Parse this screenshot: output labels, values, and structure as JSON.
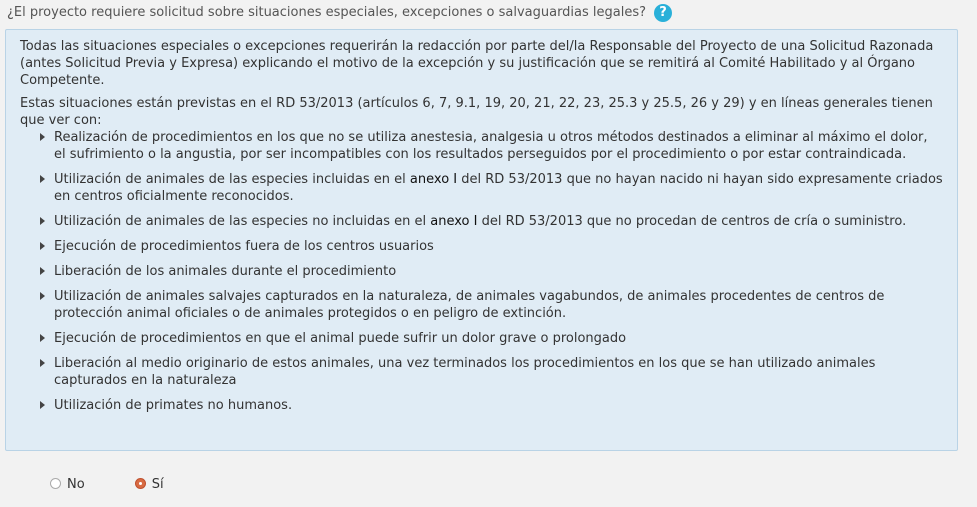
{
  "question": {
    "text": "¿El proyecto requiere solicitud sobre situaciones especiales, excepciones o salvaguardias legales?",
    "help_icon": "?"
  },
  "info": {
    "intro": "Todas las situaciones especiales o excepciones requerirán la redacción por parte del/la Responsable del Proyecto de una Solicitud Razonada (antes Solicitud Previa y Expresa) explicando el motivo de la excepción y su justificación que se remitirá al Comité Habilitado y al Órgano Competente.",
    "lead": "Estas situaciones están previstas en el RD 53/2013 (artículos 6, 7, 9.1, 19, 20, 21, 22, 23, 25.3 y 25.5, 26 y 29) y en líneas generales tienen que ver con:",
    "items": [
      "Realización de procedimientos en los que no se utiliza anestesia, analgesia u otros métodos destinados a eliminar al máximo el dolor, el sufrimiento o la angustia, por ser incompatibles con los resultados perseguidos por el procedimiento o por estar contraindicada.",
      {
        "before": "Utilización de animales de las especies incluidas en el ",
        "link": "anexo I",
        "after": " del RD 53/2013 que no hayan nacido ni hayan sido expresamente criados en centros oficialmente reconocidos."
      },
      {
        "before": "Utilización de animales de las especies no incluidas en el ",
        "link": "anexo I",
        "after": " del RD 53/2013 que no procedan de centros de cría o suministro."
      },
      "Ejecución de procedimientos fuera de los centros usuarios",
      "Liberación de los animales durante el procedimiento",
      "Utilización de animales salvajes capturados en la naturaleza, de animales vagabundos, de animales procedentes de centros de protección animal oficiales o de animales protegidos o en peligro de extinción.",
      "Ejecución de procedimientos en que el animal puede sufrir un dolor grave o prolongado",
      "Liberación al medio originario de estos animales, una vez terminados los procedimientos en los que se han utilizado animales capturados en la naturaleza",
      "Utilización de primates no humanos."
    ]
  },
  "answer": {
    "options": [
      "No",
      "Sí"
    ],
    "selected": "Sí"
  },
  "colors": {
    "help_icon": "#29b0d9",
    "info_bg": "#e0ecf5",
    "info_border": "#b9d3e6",
    "radio_selected": "#d86b43"
  }
}
